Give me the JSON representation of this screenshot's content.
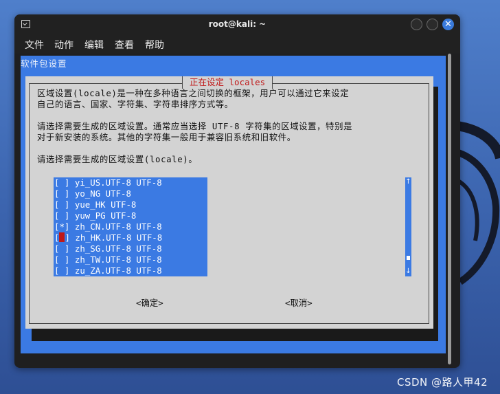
{
  "window": {
    "title": "root@kali: ~",
    "accent": "#3a7bdc"
  },
  "menubar": {
    "items": [
      "文件",
      "动作",
      "编辑",
      "查看",
      "帮助"
    ]
  },
  "terminal": {
    "package_title": "软件包设置",
    "background": "#3b7ae3"
  },
  "dialog": {
    "title": "正在设定 locales",
    "paragraph1": [
      "区域设置(locale)是一种在多种语言之间切换的框架，用户可以通过它来设定",
      "自己的语言、国家、字符集、字符串排序方式等。"
    ],
    "paragraph2": [
      "请选择需要生成的区域设置。通常应当选择 UTF-8 字符集的区域设置，特别是",
      "对于新安装的系统。其他的字符集一般用于兼容旧系统和旧软件。"
    ],
    "paragraph3": "请选择需要生成的区域设置(locale)。",
    "list_items": [
      {
        "mark": "[ ]",
        "text": "yi_US.UTF-8 UTF-8",
        "checked": false
      },
      {
        "mark": "[ ]",
        "text": "yo_NG UTF-8",
        "checked": false
      },
      {
        "mark": "[ ]",
        "text": "yue_HK UTF-8",
        "checked": false
      },
      {
        "mark": "[ ]",
        "text": "yuw_PG UTF-8",
        "checked": false
      },
      {
        "mark": "[*]",
        "text": "zh_CN.UTF-8 UTF-8",
        "checked": true
      },
      {
        "mark": "[ ]",
        "text": "zh_HK.UTF-8 UTF-8",
        "checked": false,
        "focused": true
      },
      {
        "mark": "[ ]",
        "text": "zh_SG.UTF-8 UTF-8",
        "checked": false
      },
      {
        "mark": "[ ]",
        "text": "zh_TW.UTF-8 UTF-8",
        "checked": false
      },
      {
        "mark": "[ ]",
        "text": "zu_ZA.UTF-8 UTF-8",
        "checked": false
      }
    ],
    "scroll_up": "↑",
    "scroll_down": "↓",
    "ok_label": "<确定>",
    "cancel_label": "<取消>"
  },
  "watermark": "CSDN @路人甲42"
}
